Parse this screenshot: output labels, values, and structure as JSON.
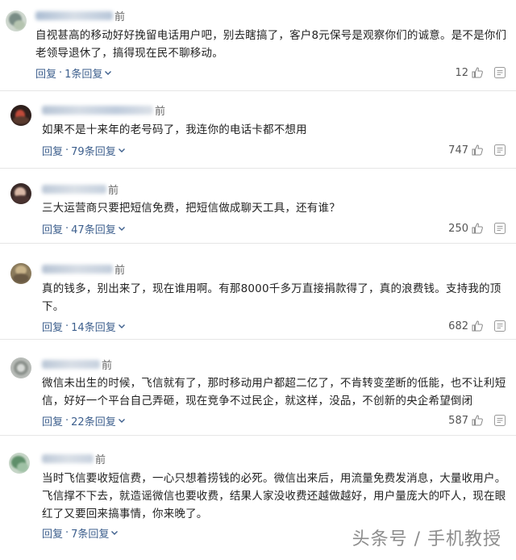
{
  "comments": [
    {
      "time_suffix": "前",
      "text": "自视甚高的移动好好挽留电话用户吧，别去瞎搞了，客户8元保号是观察你们的诚意。是不是你们老领导退休了，搞得现在民不聊移动。",
      "reply_label": "回复",
      "replies_label": "1条回复",
      "likes": "12"
    },
    {
      "time_suffix": "前",
      "text": "如果不是十来年的老号码了，我连你的电话卡都不想用",
      "reply_label": "回复",
      "replies_label": "79条回复",
      "likes": "747"
    },
    {
      "time_suffix": "前",
      "text": "三大运营商只要把短信免费，把短信做成聊天工具，还有谁？",
      "reply_label": "回复",
      "replies_label": "47条回复",
      "likes": "250"
    },
    {
      "time_suffix": "前",
      "text": "真的钱多，别出来了，现在谁用啊。有那8000千多万直接捐款得了，真的浪费钱。支持我的顶下。",
      "reply_label": "回复",
      "replies_label": "14条回复",
      "likes": "682"
    },
    {
      "time_suffix": "前",
      "text": "微信未出生的时候，飞信就有了，那时移动用户都超二亿了，不肯转变垄断的低能，也不让利短信，好好一个平台自己弄砸，现在竞争不过民企，就这样，没品，不创新的央企希望倒闭",
      "reply_label": "回复",
      "replies_label": "22条回复",
      "likes": "587"
    },
    {
      "time_suffix": "前",
      "text": "当时飞信要收短信费，一心只想着捞钱的必死。微信出来后，用流量免费发消息，大量收用户。飞信撑不下去，就造谣微信也要收费，结果人家没收费还越做越好，用户量庞大的吓人，现在眼红了又要回来搞事情，你来晚了。",
      "reply_label": "回复",
      "replies_label": "7条回复",
      "likes": ""
    }
  ],
  "watermark": "头条号 / 手机教授"
}
